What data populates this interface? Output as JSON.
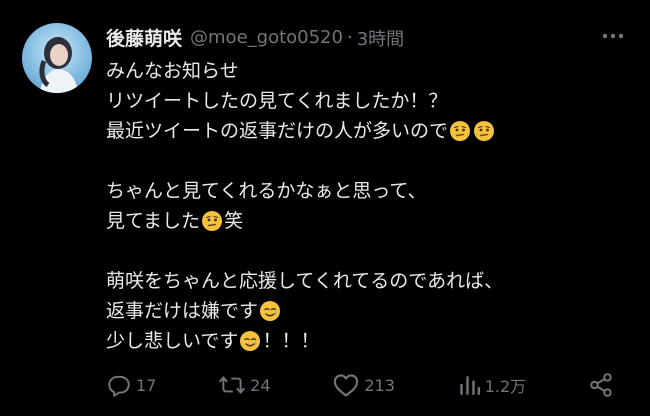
{
  "author": {
    "display_name": "後藤萌咲",
    "handle": "@moe_goto0520",
    "separator": "·",
    "time": "3時間"
  },
  "icons": {
    "more": "more-dots-icon",
    "reply": "reply-icon",
    "retweet": "retweet-icon",
    "like": "heart-icon",
    "views": "analytics-icon",
    "share": "share-icon",
    "emoji": "thinking-face-emoji",
    "emoji_tear": "smiling-face-with-tear-emoji"
  },
  "tweet": {
    "line1": "みんなお知らせ",
    "line2": "リツイートしたの見てくれましたか！？",
    "line3": "最近ツイートの返事だけの人が多いので",
    "line4": "ちゃんと見てくれるかなぁと思って、",
    "line5a": "見てました",
    "line5b": "笑",
    "line6": "萌咲をちゃんと応援してくれてるのであれば、",
    "line7": "返事だけは嫌です",
    "line8a": "少し悲しいです",
    "line8b": "！！！"
  },
  "stats": {
    "replies": "17",
    "retweets": "24",
    "likes": "213",
    "views": "1.2万"
  },
  "colors": {
    "background": "#000000",
    "text": "#e7e9ea",
    "muted": "#71767b",
    "emoji_face": "#f5c23b"
  }
}
